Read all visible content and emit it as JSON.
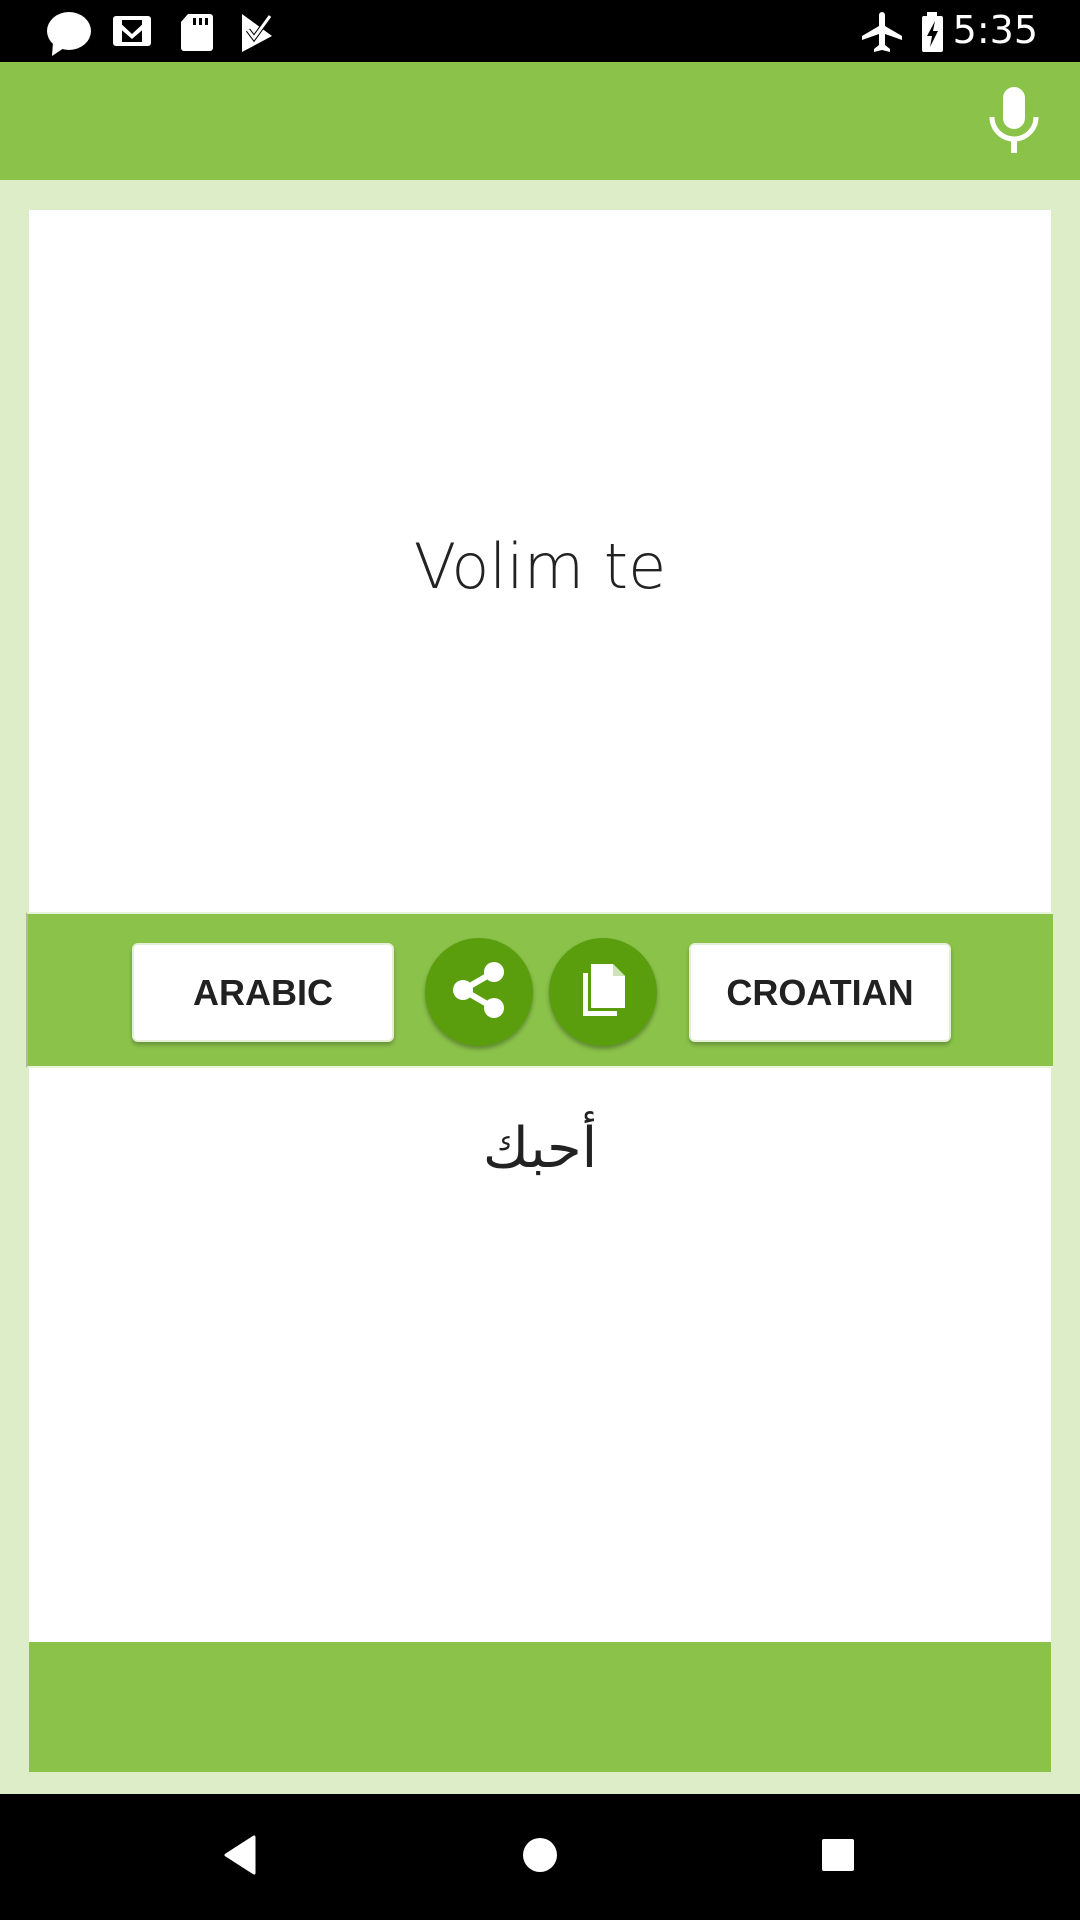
{
  "status_bar": {
    "time": "5:35",
    "left_icons": [
      "chat-bubble-icon",
      "gmail-icon",
      "sd-card-icon",
      "play-store-check-icon"
    ],
    "right_icons": [
      "airplane-mode-icon",
      "battery-charging-icon"
    ]
  },
  "app_bar": {
    "actions": [
      {
        "icon": "microphone-icon",
        "label": "Voice input"
      }
    ]
  },
  "source": {
    "text": "Volim te"
  },
  "language_bar": {
    "source_language": "ARABIC",
    "target_language": "CROATIAN",
    "share_icon": "share-icon",
    "copy_icon": "copy-icon"
  },
  "target": {
    "text": "أحبك"
  },
  "nav_bar": {
    "buttons": [
      "back-icon",
      "home-icon",
      "recents-icon"
    ]
  },
  "colors": {
    "primary": "#8bc34a",
    "primary_dark": "#5a9e0e",
    "background": "#dcedc8",
    "card": "#ffffff",
    "text": "#222222"
  }
}
